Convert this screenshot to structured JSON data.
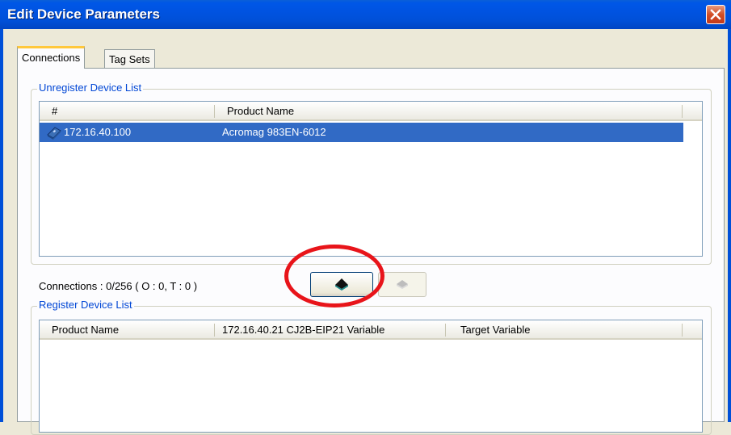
{
  "window": {
    "title": "Edit Device Parameters"
  },
  "tabs": [
    {
      "label": "Connections",
      "active": true
    },
    {
      "label": "Tag Sets",
      "active": false
    }
  ],
  "unregister": {
    "group_label": "Unregister Device List",
    "columns": [
      "#",
      "Product Name"
    ],
    "rows": [
      {
        "address": "172.16.40.100",
        "product": "Acromag 983EN-6012",
        "selected": true,
        "icon": "device-icon"
      }
    ]
  },
  "connections_status": "Connections :  0/256 ( O : 0, T : 0 )",
  "buttons": {
    "register": {
      "icon": "move-up-icon",
      "enabled": true
    },
    "unregister": {
      "icon": "move-down-icon",
      "enabled": false
    }
  },
  "register": {
    "group_label": "Register Device List",
    "columns": [
      "Product Name",
      "172.16.40.21 CJ2B-EIP21 Variable",
      "Target Variable"
    ]
  },
  "colors": {
    "title_bar": "#0050d8",
    "selection": "#316ac5",
    "highlight_ring": "#e8141a"
  }
}
